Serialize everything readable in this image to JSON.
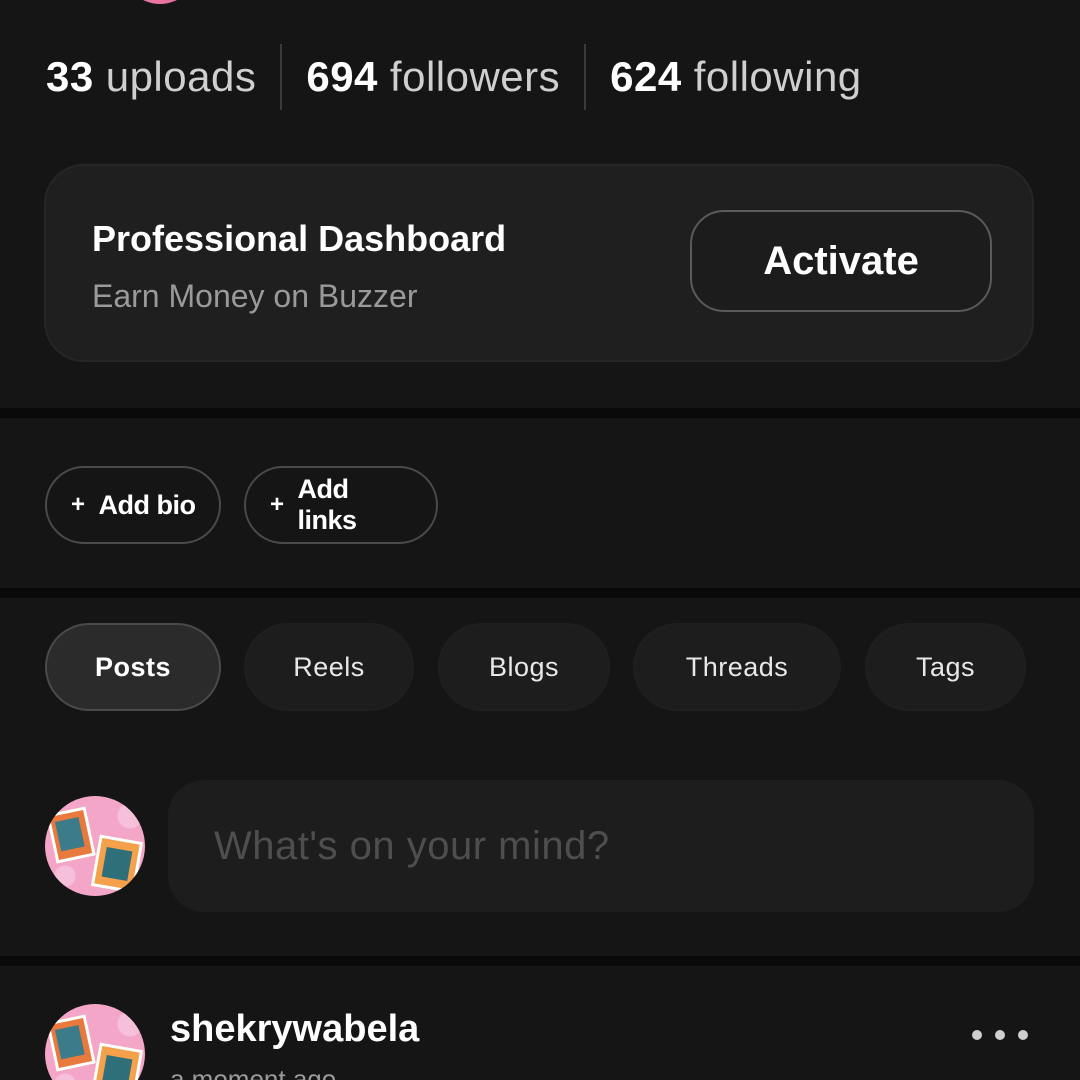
{
  "stats": {
    "uploads": {
      "count": "33",
      "label": "uploads"
    },
    "followers": {
      "count": "694",
      "label": "followers"
    },
    "following": {
      "count": "624",
      "label": "following"
    }
  },
  "professional_dashboard": {
    "title": "Professional Dashboard",
    "subtitle": "Earn Money on Buzzer",
    "button_label": "Activate"
  },
  "profile_actions": {
    "add_bio": "Add bio",
    "add_links": "Add links"
  },
  "tabs": [
    {
      "label": "Posts",
      "active": true
    },
    {
      "label": "Reels",
      "active": false
    },
    {
      "label": "Blogs",
      "active": false
    },
    {
      "label": "Threads",
      "active": false
    },
    {
      "label": "Tags",
      "active": false
    }
  ],
  "composer": {
    "placeholder": "What's on your mind?"
  },
  "post": {
    "username": "shekrywabela",
    "time": "a moment ago"
  }
}
